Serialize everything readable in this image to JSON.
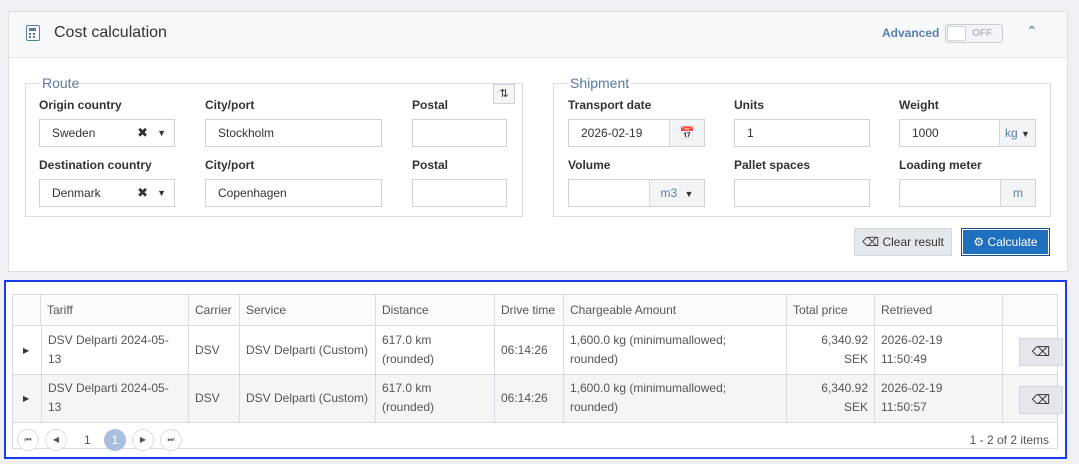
{
  "header": {
    "title": "Cost calculation",
    "advanced_label": "Advanced",
    "advanced_toggle": "OFF"
  },
  "route": {
    "legend": "Route",
    "origin_country_label": "Origin country",
    "origin_country_value": "Sweden",
    "origin_city_label": "City/port",
    "origin_city_value": "Stockholm",
    "origin_postal_label": "Postal",
    "origin_postal_value": "",
    "dest_country_label": "Destination country",
    "dest_country_value": "Denmark",
    "dest_city_label": "City/port",
    "dest_city_value": "Copenhagen",
    "dest_postal_label": "Postal",
    "dest_postal_value": ""
  },
  "shipment": {
    "legend": "Shipment",
    "transport_date_label": "Transport date",
    "transport_date_value": "2026-02-19",
    "units_label": "Units",
    "units_value": "1",
    "weight_label": "Weight",
    "weight_value": "1000",
    "weight_unit": "kg",
    "volume_label": "Volume",
    "volume_value": "",
    "volume_unit": "m3",
    "pallet_label": "Pallet spaces",
    "pallet_value": "",
    "loading_label": "Loading meter",
    "loading_value": "",
    "loading_unit": "m"
  },
  "actions": {
    "clear_label": "Clear result",
    "calculate_label": "Calculate"
  },
  "table": {
    "columns": [
      "Tariff",
      "Carrier",
      "Service",
      "Distance",
      "Drive time",
      "Chargeable Amount",
      "Total price",
      "Retrieved"
    ],
    "rows": [
      {
        "tariff_l1": "DSV Delparti 2024-05-",
        "tariff_l2": "13",
        "carrier": "DSV",
        "service": "DSV Delparti (Custom)",
        "distance_l1": "617.0 km",
        "distance_l2": "(rounded)",
        "drive_time": "06:14:26",
        "charge_l1": "1,600.0 kg (minimumallowed;",
        "charge_l2": "rounded)",
        "price_l1": "6,340.92",
        "price_l2": "SEK",
        "retrieved_l1": "2026-02-19",
        "retrieved_l2": "11:50:49"
      },
      {
        "tariff_l1": "DSV Delparti 2024-05-",
        "tariff_l2": "13",
        "carrier": "DSV",
        "service": "DSV Delparti (Custom)",
        "distance_l1": "617.0 km",
        "distance_l2": "(rounded)",
        "drive_time": "06:14:26",
        "charge_l1": "1,600.0 kg (minimumallowed;",
        "charge_l2": "rounded)",
        "price_l1": "6,340.92",
        "price_l2": "SEK",
        "retrieved_l1": "2026-02-19",
        "retrieved_l2": "11:50:57"
      }
    ]
  },
  "pager": {
    "page_label": "1",
    "current_page": "1",
    "info": "1 - 2 of 2 items"
  },
  "icons": {
    "header": "calculator-icon",
    "collapse": "chevron-up-icon",
    "swap": "swap-vertical-icon",
    "calendar": "calendar-icon",
    "eraser": "eraser-icon",
    "gears": "gears-icon"
  }
}
